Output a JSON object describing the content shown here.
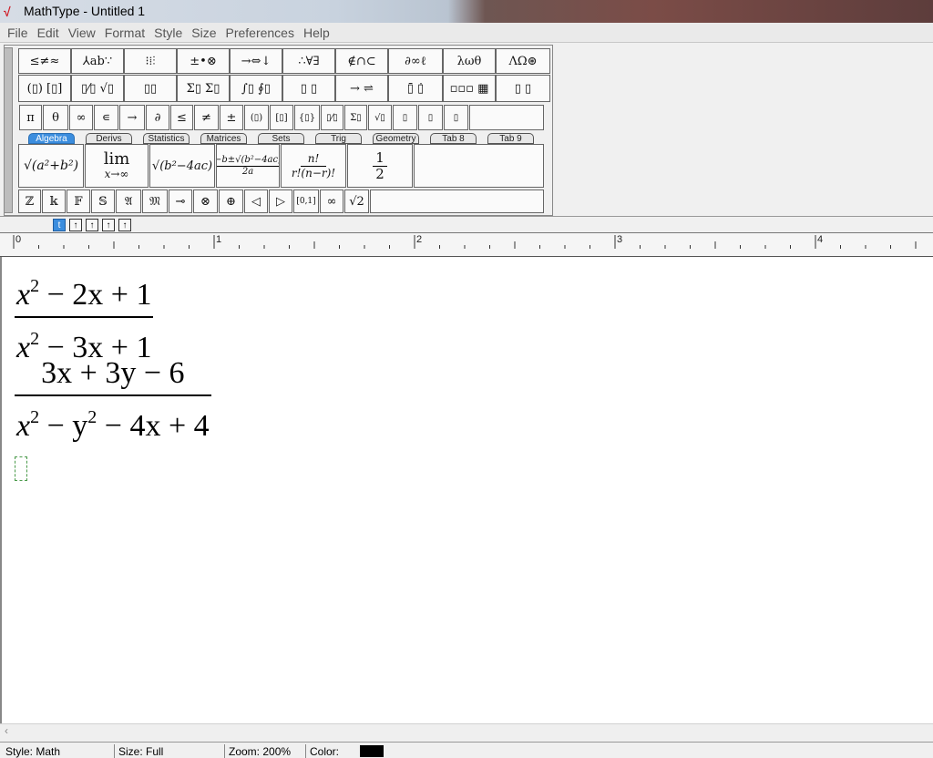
{
  "window": {
    "title": "MathType - Untitled 1"
  },
  "menu": [
    "File",
    "Edit",
    "View",
    "Format",
    "Style",
    "Size",
    "Preferences",
    "Help"
  ],
  "palette_row1": [
    "≤≠≈",
    "⅄ab∵",
    "⁝⁞⫶",
    "±•⊗",
    "→⇔↓",
    "∴∀∃",
    "∉∩⊂",
    "∂∞ℓ",
    "λωθ",
    "ΛΩ⊛"
  ],
  "palette_row2": [
    "(▯) [▯]",
    "▯⁄▯ √▯",
    "▯▯",
    "Σ▯ Σ▯",
    "∫▯ ∮▯",
    "▯ ▯",
    "→ ⇌",
    "▯̄ ▯̇",
    "▫▫▫ ▦",
    "▯ ▯"
  ],
  "small_bar_1": [
    "π",
    "θ",
    "∞",
    "∊",
    "→",
    "∂",
    "≤",
    "≠",
    "±",
    "(▯)",
    "[▯]",
    "{▯}",
    "▯⁄▯",
    "Σ▯",
    "√▯",
    "▯",
    "▯",
    "▯"
  ],
  "tabs": [
    "Algebra",
    "Derivs",
    "Statistics",
    "Matrices",
    "Sets",
    "Trig",
    "Geometry",
    "Tab 8",
    "Tab 9"
  ],
  "templates": [
    "√(a²+b²)",
    "lim",
    "x→∞",
    "√(b²−4ac)",
    "−b±√(b²−4ac)",
    "2a",
    "n!",
    "r!(n−r)!",
    "1",
    "2"
  ],
  "small_bar_2": [
    "ℤ",
    "𝕜",
    "𝔽",
    "𝕊",
    "𝔄",
    "𝔐",
    "⊸",
    "⊗",
    "⊕",
    "◁",
    "▷",
    "[0,1]",
    "∞",
    "√2"
  ],
  "nudge_buttons": [
    "t",
    "↑",
    "↑",
    "↑",
    "↑"
  ],
  "ruler": [
    "0",
    "1",
    "2",
    "3",
    "4"
  ],
  "equation1": {
    "num_a": "x",
    "num_exp": "2",
    "num_b": " − 2x + 1",
    "den_a": "x",
    "den_exp": "2",
    "den_b": " − 3x + 1"
  },
  "equation2": {
    "num": "3x + 3y − 6",
    "den_a": "x",
    "den_exp1": "2",
    "den_b": " − y",
    "den_exp2": "2",
    "den_c": " − 4x + 4"
  },
  "status": {
    "style": "Style: Math",
    "size": "Size: Full",
    "zoom": "Zoom: 200%",
    "color_label": "Color:"
  },
  "colors": {
    "swatch": "#000000",
    "active_tab": "#3b8dde"
  }
}
